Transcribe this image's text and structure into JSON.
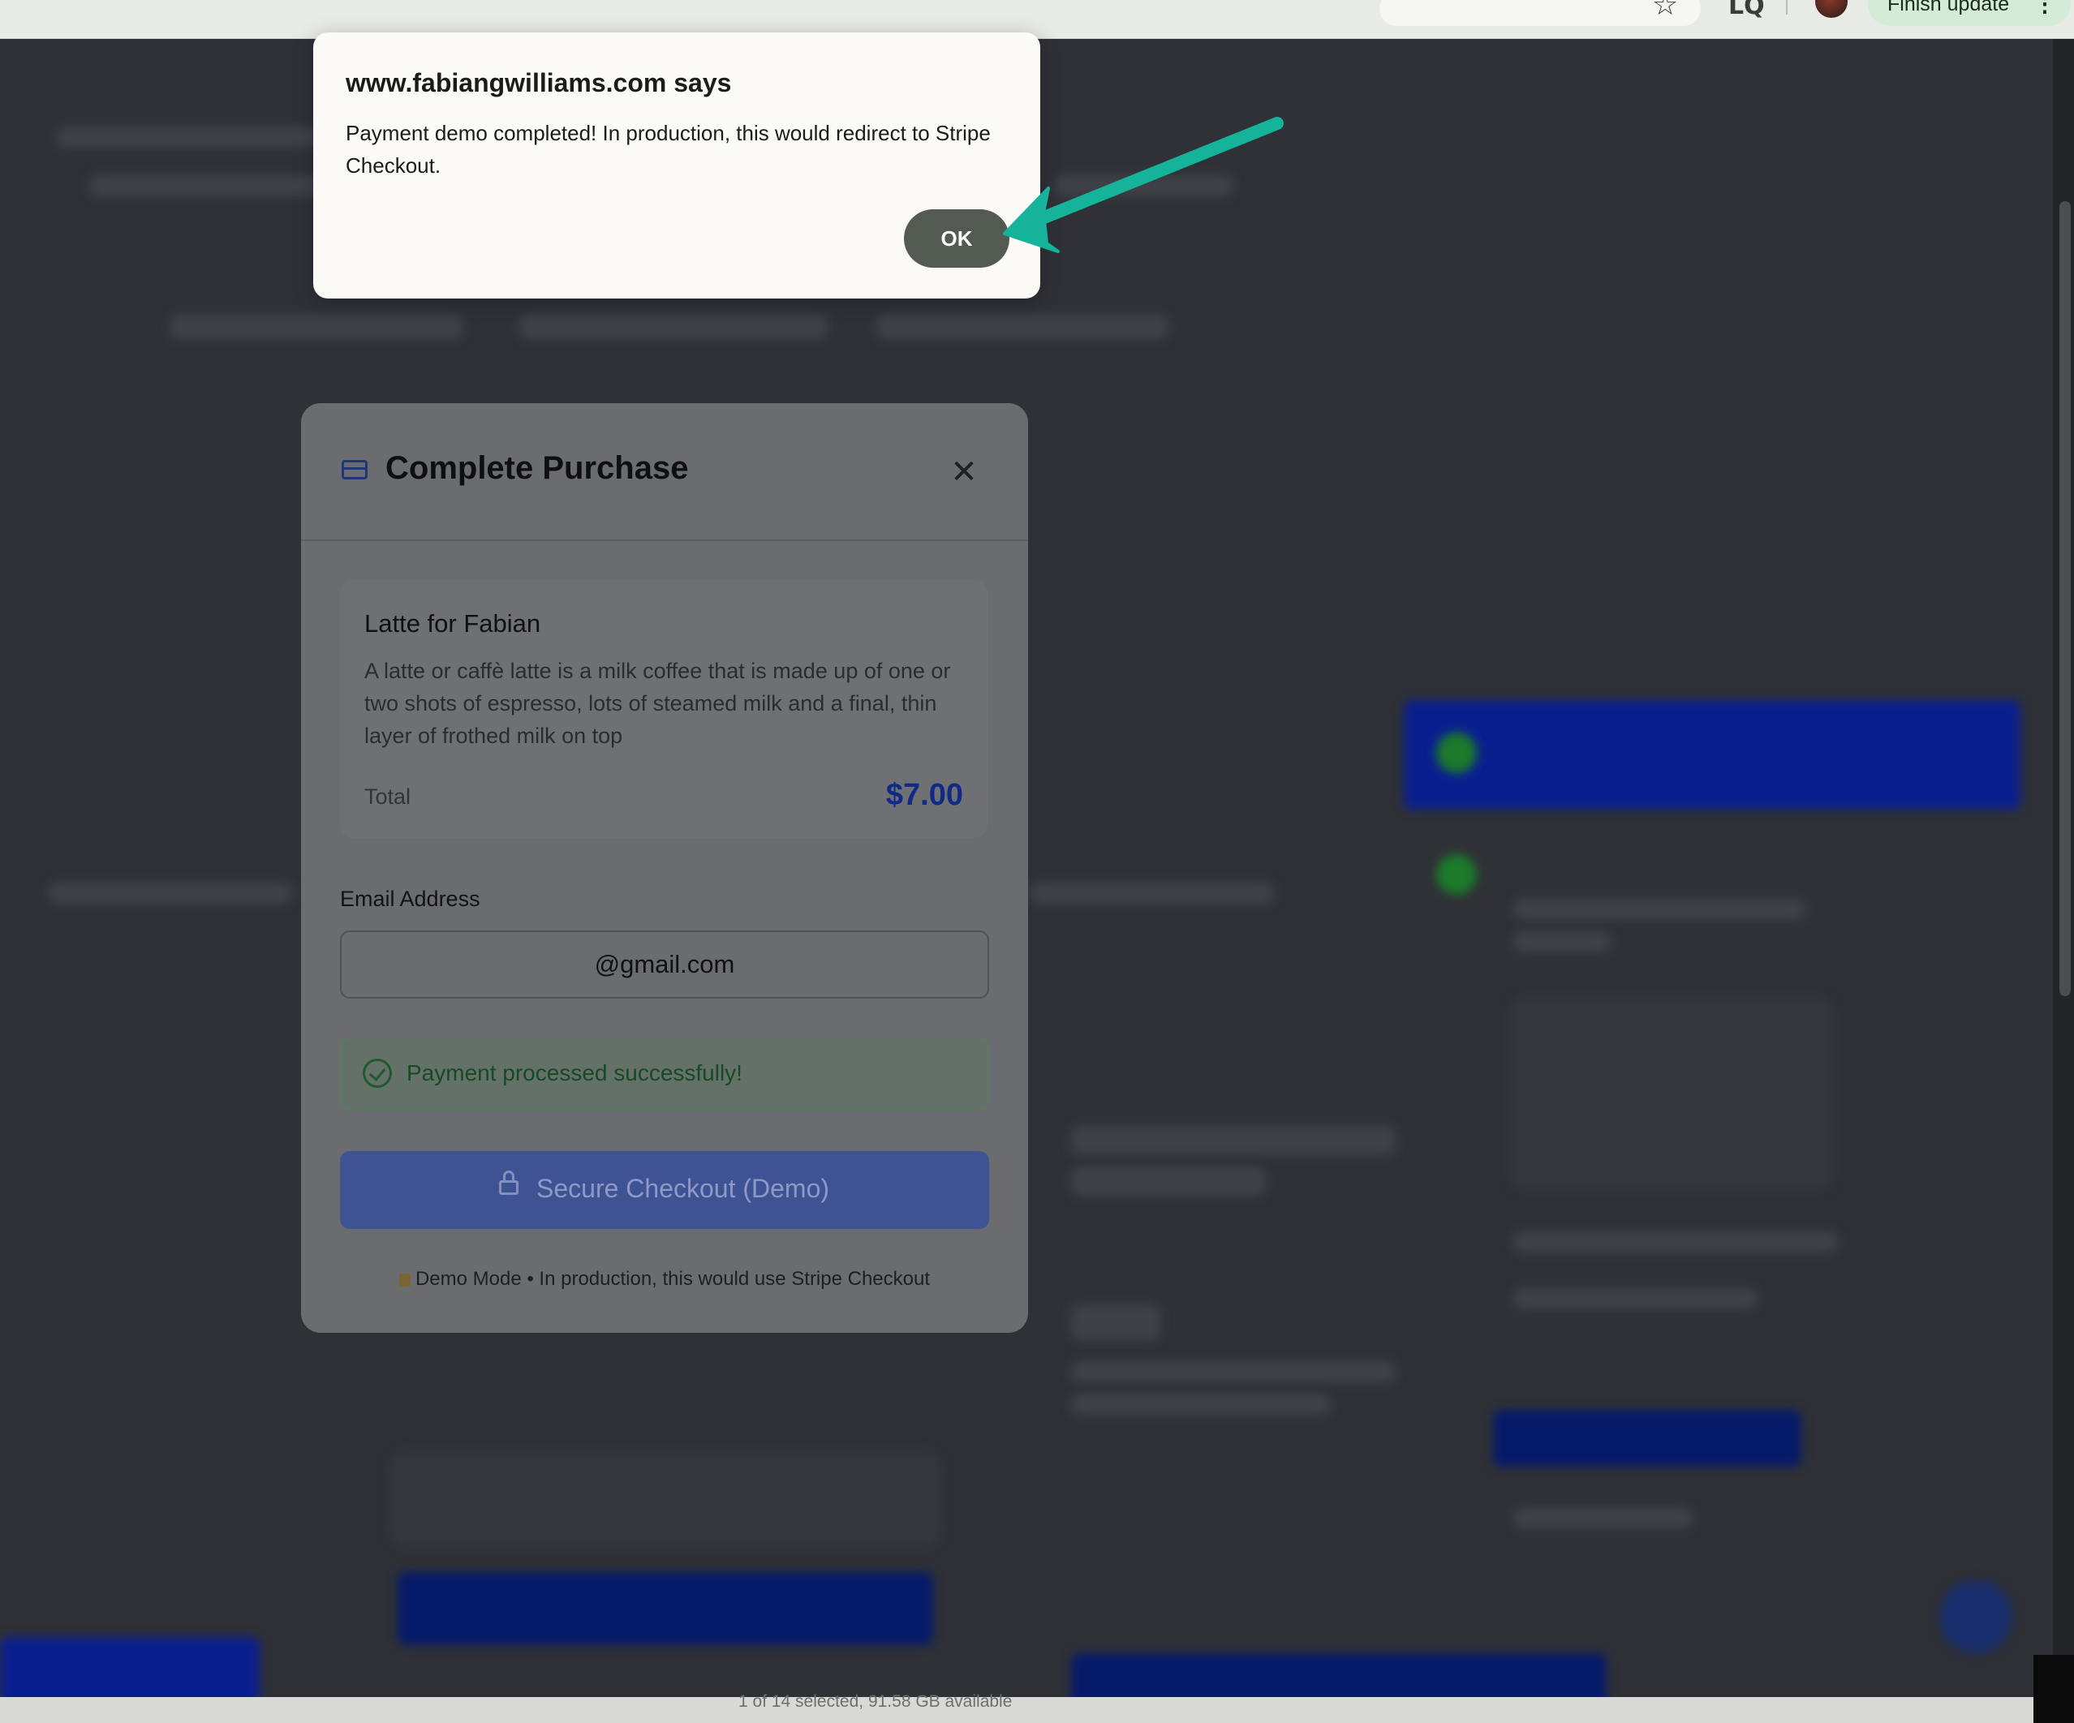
{
  "browser": {
    "finish_update_label": "Finish update",
    "menu_glyph": "⋮",
    "bookmark_glyph": "☆",
    "lens_glyph": "LQ"
  },
  "alert": {
    "origin": "www.fabiangwilliams.com says",
    "message": "Payment demo completed! In production, this would redirect to Stripe Checkout.",
    "ok_label": "OK"
  },
  "modal": {
    "title": "Complete Purchase",
    "close_glyph": "✕",
    "product": {
      "name": "Latte for Fabian",
      "description": "A latte or caffè latte is a milk coffee that is made up of one or two shots of espresso, lots of steamed milk and a final, thin layer of frothed milk on top",
      "total_label": "Total",
      "total_value": "$7.00"
    },
    "email_label": "Email Address",
    "email_value": "@gmail.com",
    "success_message": "Payment processed successfully!",
    "checkout_button": "Secure Checkout (Demo)",
    "demo_note": "Demo Mode • In production, this would use Stripe Checkout"
  },
  "status_bar": {
    "text": "1 of 14 selected, 91.58 GB available"
  },
  "colors": {
    "annotation_arrow": "#15b39a",
    "price_accent": "#102a86",
    "ok_button": "#525a52"
  }
}
